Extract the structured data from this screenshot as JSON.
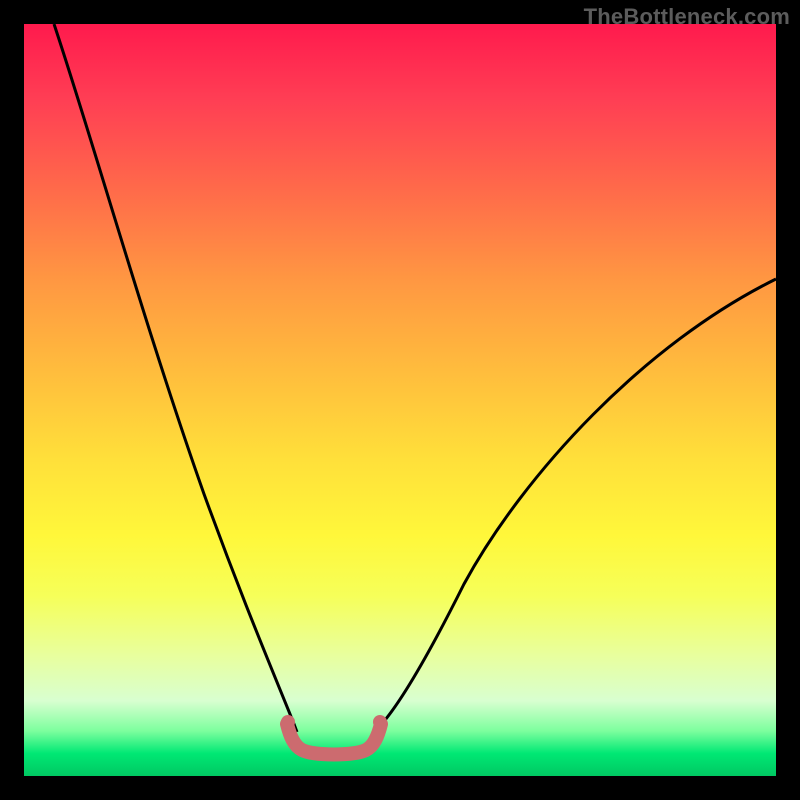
{
  "watermark": "TheBottleneck.com",
  "chart_data": {
    "type": "line",
    "title": "",
    "xlabel": "",
    "ylabel": "",
    "xlim": [
      0,
      100
    ],
    "ylim": [
      0,
      100
    ],
    "grid": false,
    "series": [
      {
        "name": "left-curve",
        "x": [
          4,
          8,
          12,
          16,
          20,
          24,
          28,
          31,
          33,
          35,
          36
        ],
        "values": [
          100,
          84,
          68,
          54,
          41,
          29,
          19,
          12,
          8,
          6,
          5
        ]
      },
      {
        "name": "right-curve",
        "x": [
          46,
          48,
          50,
          53,
          57,
          62,
          68,
          75,
          82,
          90,
          100
        ],
        "values": [
          5,
          6,
          8,
          12,
          18,
          25,
          33,
          41,
          49,
          57,
          66
        ]
      },
      {
        "name": "valley-marker",
        "x": [
          35,
          36,
          37,
          38,
          40,
          42,
          44,
          45,
          46,
          47
        ],
        "values": [
          6,
          4.5,
          3.5,
          3,
          3,
          3,
          3,
          3.5,
          4.5,
          6
        ]
      }
    ],
    "gradient_stops": [
      {
        "pct": 0,
        "color": "#ff1a4d"
      },
      {
        "pct": 50,
        "color": "#ffe03a"
      },
      {
        "pct": 90,
        "color": "#d8ffd0"
      },
      {
        "pct": 100,
        "color": "#00c862"
      }
    ]
  }
}
